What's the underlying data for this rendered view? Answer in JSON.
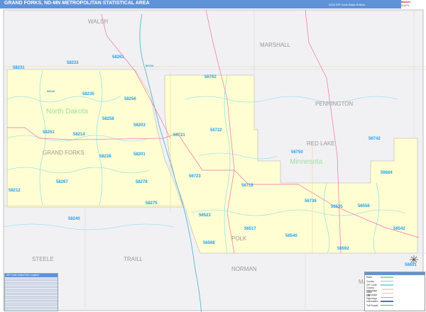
{
  "header": {
    "title": "GRAND FORKS, ND-MN METROPOLITAN STATISTICAL AREA",
    "edition": "2023 ZIP Code Basic Edition",
    "logo": "Market MAPS"
  },
  "states": [
    {
      "name": "North Dakota"
    },
    {
      "name": "Minnesota"
    }
  ],
  "counties": [
    "WALSH",
    "MARSHALL",
    "PENNINGTON",
    "RED LAKE",
    "GRAND FORKS",
    "POLK",
    "STEELE",
    "TRAILL",
    "NORMAN",
    "MA"
  ],
  "zips": [
    "58231",
    "58233",
    "58261",
    "56744",
    "58244",
    "58235",
    "58256",
    "56762",
    "58258",
    "58203",
    "58251",
    "58214",
    "56721",
    "56722",
    "58228",
    "58201",
    "58267",
    "58278",
    "58212",
    "58275",
    "56723",
    "56716",
    "56523",
    "56517",
    "56568",
    "56540",
    "56736",
    "56535",
    "56556",
    "56542",
    "56592",
    "56750",
    "56742",
    "56684",
    "58240",
    "56651"
  ],
  "index": {
    "title": "ZIP Code Index/Grid Location"
  },
  "legend": {
    "items": [
      {
        "label": "State",
        "color": "#8ee08e"
      },
      {
        "label": "County",
        "color": "#bbbbbb"
      },
      {
        "label": "ZIP Code",
        "color": "#7fd8f0"
      },
      {
        "label": "County Highways",
        "color": "#dddddd"
      },
      {
        "label": "State Highways",
        "color": "#f5c98a"
      },
      {
        "label": "US Highways",
        "color": "#f080c0"
      },
      {
        "label": "Interstates",
        "color": "#4070e0"
      },
      {
        "label": "Toll Roads",
        "color": "#40c040"
      }
    ]
  },
  "colors": {
    "metro": "#fefed2",
    "outside": "#f1f1f3",
    "zipline": "#7fd8f0",
    "highway": "#f070b0",
    "header": "#5f93d8"
  }
}
